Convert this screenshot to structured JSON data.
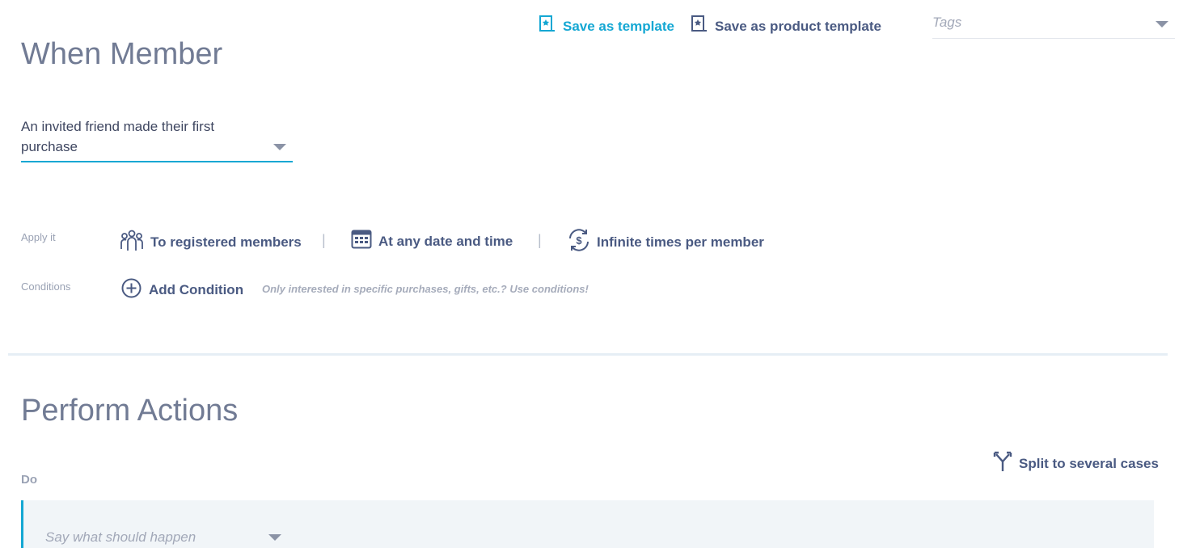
{
  "header": {
    "save_template_label": "Save as template",
    "save_product_template_label": "Save as product template",
    "tags_placeholder": "Tags"
  },
  "trigger": {
    "section_title": "When Member",
    "selected_line1": "An invited friend made their first",
    "selected_line2": "purchase"
  },
  "apply": {
    "label": "Apply it",
    "registered_members": "To registered members",
    "date_time": "At any date and time",
    "times": "Infinite times per member",
    "separator": "|"
  },
  "conditions": {
    "label": "Conditions",
    "add_label": "Add Condition",
    "hint": "Only interested in specific purchases, gifts, etc.? Use conditions!"
  },
  "actions": {
    "section_title": "Perform Actions",
    "split_label": "Split to several cases",
    "do_label": "Do",
    "action_placeholder": "Say what should happen"
  },
  "colors": {
    "teal": "#14a7d3",
    "navy": "#4a5a82",
    "panel": "#f1f5f8"
  }
}
